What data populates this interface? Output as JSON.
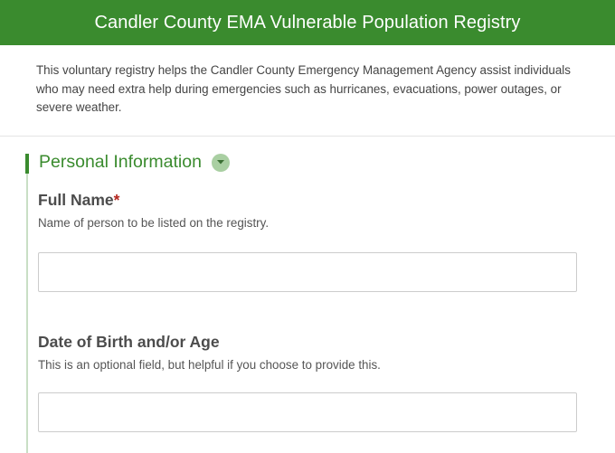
{
  "header": {
    "title": "Candler County EMA Vulnerable Population Registry"
  },
  "intro": {
    "text": "This voluntary registry helps the Candler County Emergency Management Agency assist individuals who may need extra help during emergencies such as hurricanes, evacuations, power outages, or severe weather."
  },
  "section": {
    "title": "Personal Information",
    "toggle_icon": "chevron-down-icon",
    "accent_color": "#3a8b2e"
  },
  "fields": [
    {
      "label": "Full Name",
      "required_marker": "*",
      "description": "Name of person to be listed on the registry.",
      "value": "",
      "placeholder": ""
    },
    {
      "label": "Date of Birth and/or Age",
      "description": "This is an optional field, but helpful if you choose to provide this.",
      "value": "",
      "placeholder": ""
    }
  ]
}
